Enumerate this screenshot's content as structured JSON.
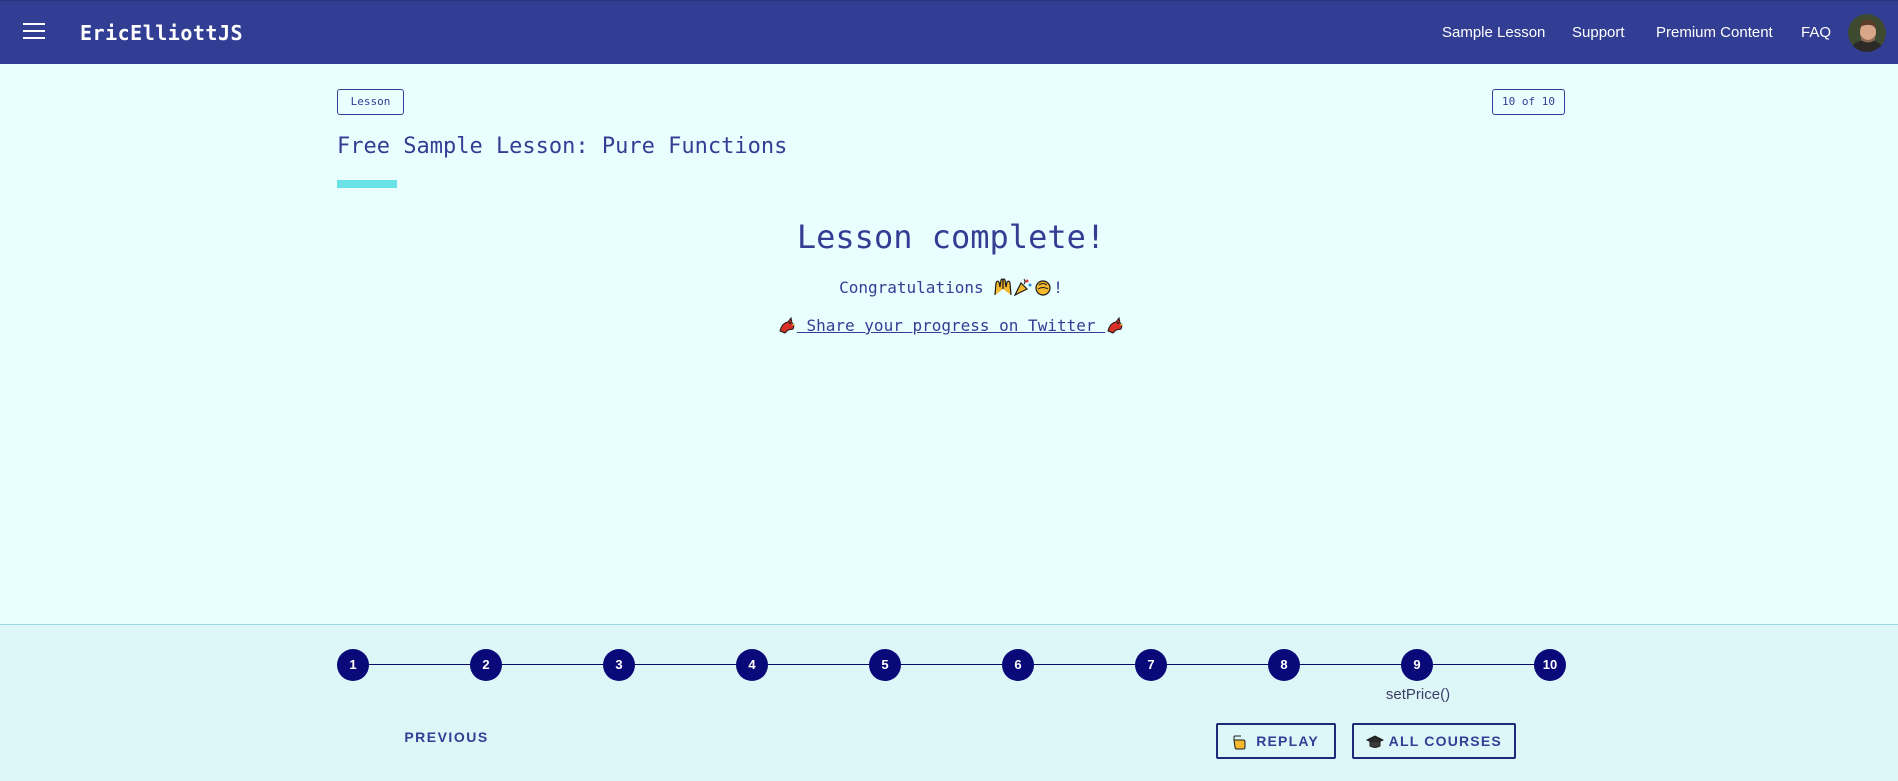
{
  "header": {
    "brand": "EricElliottJS",
    "nav": [
      "Sample Lesson",
      "Support",
      "Premium Content",
      "FAQ"
    ]
  },
  "lesson": {
    "type_badge": "Lesson",
    "progress_badge": "10 of 10",
    "title": "Free Sample Lesson: Pure Functions",
    "complete_heading": "Lesson complete!",
    "congrats_text": "Congratulations",
    "congrats_suffix": "!",
    "share_text": "Share your progress on Twitter"
  },
  "footer": {
    "steps": [
      "1",
      "2",
      "3",
      "4",
      "5",
      "6",
      "7",
      "8",
      "9",
      "10"
    ],
    "step_label": "setPrice()",
    "previous": "PREVIOUS",
    "replay": "REPLAY",
    "all_courses": "ALL COURSES"
  },
  "colors": {
    "topbar": "#323e94",
    "background": "#e9fefe",
    "accent": "#6ae3e6",
    "step": "#090979"
  },
  "icons": [
    "menu-icon",
    "avatar",
    "raising-hands-icon",
    "party-popper-icon",
    "clapping-hands-icon",
    "cardinal-bird-icon",
    "backhand-pointing-icon",
    "graduation-cap-icon"
  ]
}
